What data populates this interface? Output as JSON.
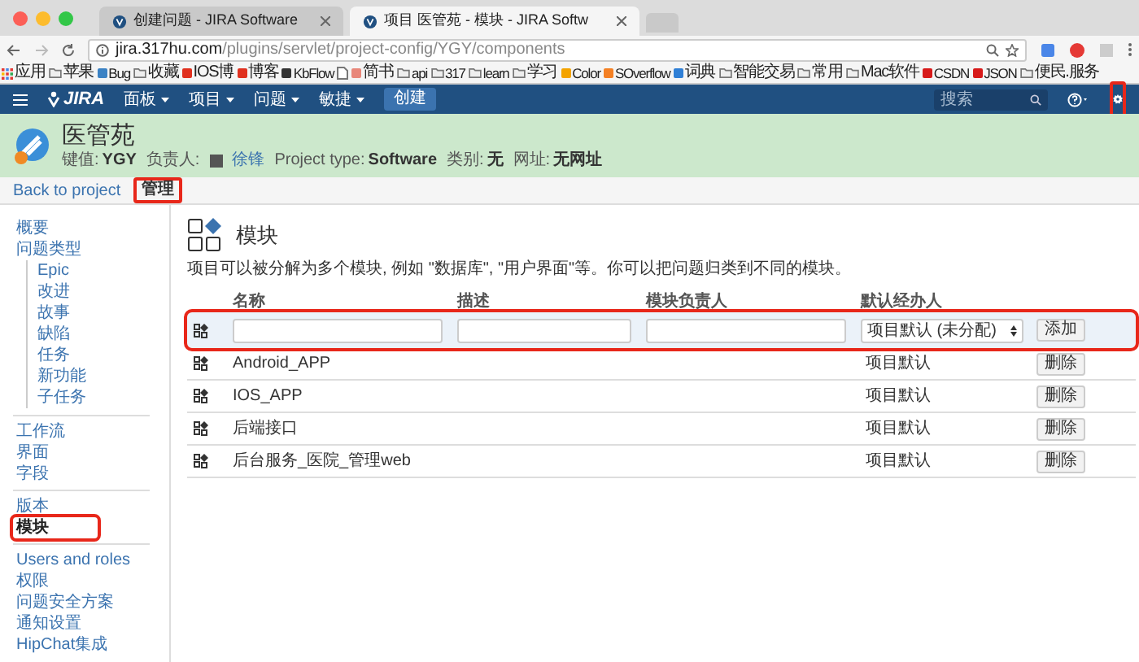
{
  "browser": {
    "tabs": [
      {
        "title": "创建问题 - JIRA Software",
        "selected": false
      },
      {
        "title": "项目 医管苑 - 模块 - JIRA Softw",
        "selected": true
      }
    ],
    "url": {
      "host": "jira.317hu.com",
      "path": "/plugins/servlet/project-config/YGY/components"
    },
    "bookmarks": [
      {
        "label": "应用",
        "kind": "apps"
      },
      {
        "label": "苹果",
        "kind": "folder"
      },
      {
        "label": "Bug",
        "kind": "site",
        "color": "#3b82c4"
      },
      {
        "label": "收藏",
        "kind": "folder"
      },
      {
        "label": "IOS博",
        "kind": "site",
        "color": "#e0301e"
      },
      {
        "label": "博客",
        "kind": "site",
        "color": "#e0301e"
      },
      {
        "label": "KbFlow",
        "kind": "site",
        "color": "#333333"
      },
      {
        "kind": "page"
      },
      {
        "label": "简书",
        "kind": "site",
        "color": "#e8877a"
      },
      {
        "label": "api",
        "kind": "folder"
      },
      {
        "label": "317",
        "kind": "folder"
      },
      {
        "label": "learn",
        "kind": "folder"
      },
      {
        "label": "学习",
        "kind": "folder"
      },
      {
        "label": "Color",
        "kind": "site",
        "color": "#f4a300"
      },
      {
        "label": "SOverflow",
        "kind": "site",
        "color": "#f48024"
      },
      {
        "label": "词典",
        "kind": "site",
        "color": "#2f7fd6"
      },
      {
        "label": "智能交易",
        "kind": "folder"
      },
      {
        "label": "常用",
        "kind": "folder"
      },
      {
        "label": "Mac软件",
        "kind": "folder"
      },
      {
        "label": "CSDN",
        "kind": "site",
        "color": "#d71a1a"
      },
      {
        "label": "JSON",
        "kind": "site",
        "color": "#d71a1a"
      },
      {
        "label": "便民.服务",
        "kind": "folder"
      }
    ]
  },
  "nav": {
    "logo": "JIRA",
    "menus": [
      "面板",
      "项目",
      "问题",
      "敏捷"
    ],
    "create": "创建",
    "search": {
      "placeholder": "搜索"
    },
    "settings_highlighted": true
  },
  "project": {
    "name": "医管苑",
    "meta": [
      {
        "label": "键值:",
        "value": "YGY",
        "kind": "text"
      },
      {
        "label": "负责人:",
        "value": "徐锋",
        "kind": "user"
      },
      {
        "label": "Project type:",
        "value": "Software",
        "kind": "text"
      },
      {
        "label": "类别:",
        "value": "无",
        "kind": "text"
      },
      {
        "label": "网址:",
        "value": "无网址",
        "kind": "text"
      }
    ]
  },
  "subnav": {
    "back": "Back to project",
    "current": "管理",
    "current_highlighted": true
  },
  "sidebar": {
    "groups": [
      [
        {
          "label": "概要",
          "selected": false,
          "highlighted": false
        },
        {
          "label": "问题类型",
          "selected": false,
          "highlighted": false,
          "children": [
            {
              "label": "Epic",
              "selected": false
            },
            {
              "label": "改进",
              "selected": false
            },
            {
              "label": "故事",
              "selected": false
            },
            {
              "label": "缺陷",
              "selected": false
            },
            {
              "label": "任务",
              "selected": false
            },
            {
              "label": "新功能",
              "selected": false
            },
            {
              "label": "子任务",
              "selected": false
            }
          ]
        }
      ],
      [
        {
          "label": "工作流",
          "selected": false,
          "highlighted": false
        },
        {
          "label": "界面",
          "selected": false,
          "highlighted": false
        },
        {
          "label": "字段",
          "selected": false,
          "highlighted": false
        }
      ],
      [
        {
          "label": "版本",
          "selected": false,
          "highlighted": false
        },
        {
          "label": "模块",
          "selected": true,
          "highlighted": true
        }
      ],
      [
        {
          "label": "Users and roles",
          "selected": false,
          "highlighted": false
        },
        {
          "label": "权限",
          "selected": false,
          "highlighted": false
        },
        {
          "label": "问题安全方案",
          "selected": false,
          "highlighted": false
        },
        {
          "label": "通知设置",
          "selected": false,
          "highlighted": false
        },
        {
          "label": "HipChat集成",
          "selected": false,
          "highlighted": false
        }
      ]
    ]
  },
  "main": {
    "title": "模块",
    "description": "项目可以被分解为多个模块, 例如 \"数据库\", \"用户界面\"等。你可以把问题归类到不同的模块。",
    "columns": [
      "名称",
      "描述",
      "模块负责人",
      "默认经办人"
    ],
    "add_row": {
      "assignee": "项目默认 (未分配)",
      "button": "添加",
      "highlighted": true
    },
    "rows": [
      {
        "name": "Android_APP",
        "assignee": "项目默认",
        "button": "删除"
      },
      {
        "name": "IOS_APP",
        "assignee": "项目默认",
        "button": "删除"
      },
      {
        "name": "后端接口",
        "assignee": "项目默认",
        "button": "删除"
      },
      {
        "name": "后台服务_医院_管理web",
        "assignee": "项目默认",
        "button": "删除"
      }
    ]
  }
}
